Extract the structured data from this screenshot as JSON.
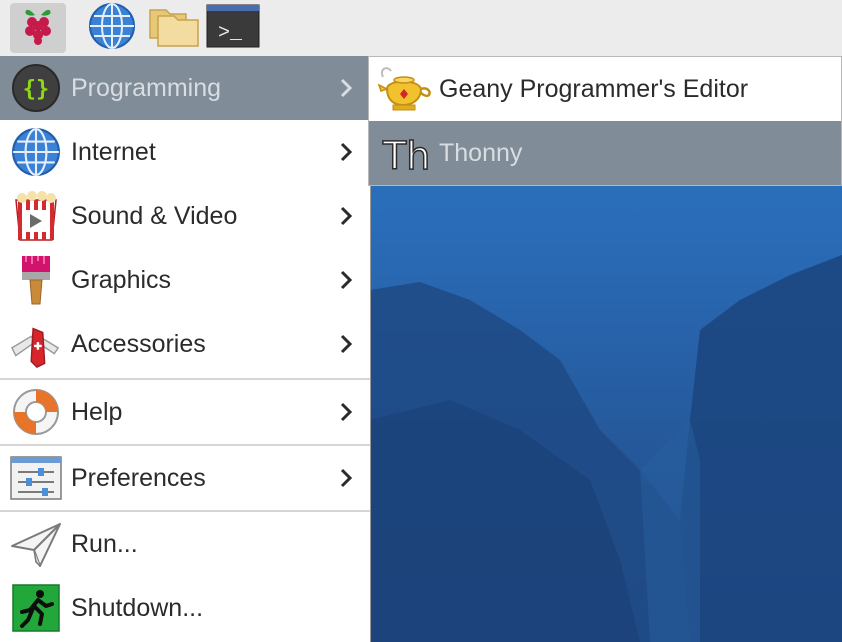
{
  "panel": {
    "buttons": [
      {
        "name": "raspberry-menu",
        "icon": "raspberry-icon"
      },
      {
        "name": "web-browser",
        "icon": "globe-icon"
      },
      {
        "name": "file-manager",
        "icon": "folder-icon"
      },
      {
        "name": "terminal",
        "icon": "terminal-icon",
        "glyph": ">_"
      }
    ]
  },
  "menu": {
    "items": [
      {
        "label": "Programming",
        "icon": "code-braces-icon",
        "submenu": true,
        "highlighted": true
      },
      {
        "label": "Internet",
        "icon": "globe-icon",
        "submenu": true
      },
      {
        "label": "Sound & Video",
        "icon": "popcorn-play-icon",
        "submenu": true
      },
      {
        "label": "Graphics",
        "icon": "paintbrush-icon",
        "submenu": true
      },
      {
        "label": "Accessories",
        "icon": "pocket-knife-icon",
        "submenu": true
      },
      {
        "label": "Help",
        "icon": "lifebuoy-icon",
        "submenu": true
      },
      {
        "label": "Preferences",
        "icon": "sliders-icon",
        "submenu": true
      },
      {
        "label": "Run...",
        "icon": "paper-plane-icon",
        "submenu": false
      },
      {
        "label": "Shutdown...",
        "icon": "exit-runner-icon",
        "submenu": false
      }
    ]
  },
  "submenu": {
    "items": [
      {
        "label": "Geany Programmer's Editor",
        "icon": "genie-lamp-icon"
      },
      {
        "label": "Thonny",
        "icon": "thonny-icon",
        "glyph": "Th",
        "highlighted": true
      }
    ]
  },
  "colors": {
    "highlight": "#808c98",
    "panel": "#ececec",
    "menu_bg": "#ffffff"
  }
}
